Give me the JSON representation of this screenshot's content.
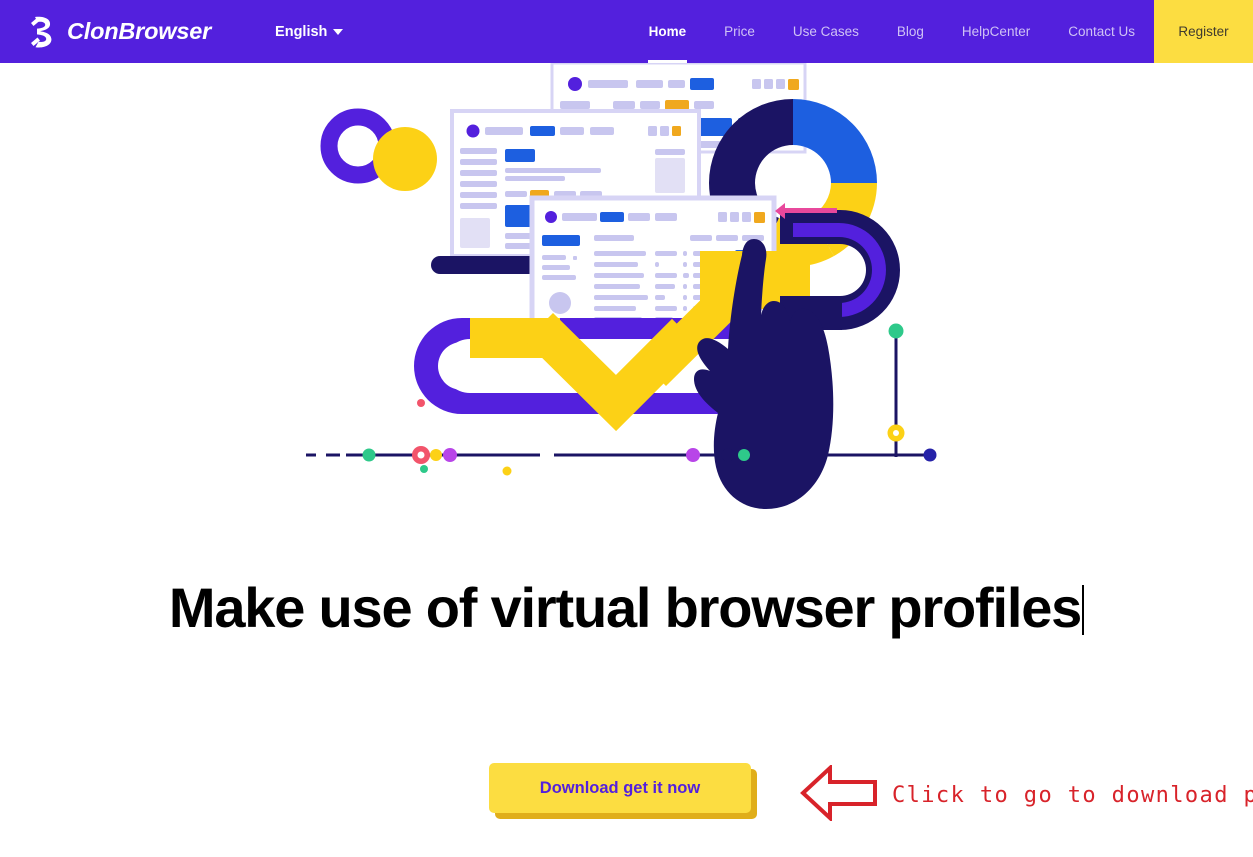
{
  "header": {
    "brand": {
      "logo_icon": "clonbrowser-logo-icon",
      "name": "ClonBrowser"
    },
    "language": {
      "label": "English",
      "caret_icon": "chevron-down-icon"
    },
    "nav": [
      {
        "label": "Home",
        "active": true
      },
      {
        "label": "Price",
        "active": false
      },
      {
        "label": "Use Cases",
        "active": false
      },
      {
        "label": "Blog",
        "active": false
      },
      {
        "label": "HelpCenter",
        "active": false
      },
      {
        "label": "Contact Us",
        "active": false
      }
    ],
    "register_label": "Register",
    "colors": {
      "bar": "#5320dd",
      "accent_yellow": "#fcdd41",
      "nav_inactive": "#cfc2f5",
      "nav_active": "#ffffff"
    }
  },
  "hero": {
    "illustration_name": "browser-profiles-illustration",
    "headline": "Make use of virtual browser profiles",
    "text_cursor": true,
    "colors": {
      "purple": "#5320dd",
      "deep_navy": "#1b1464",
      "blue": "#1d5fe0",
      "yellow": "#fcd116",
      "light_lilac": "#d7d4f5",
      "pale": "#eceaf9",
      "green": "#2ec98a",
      "pink": "#f2546b",
      "magenta": "#b845e8",
      "orange": "#f0a81e"
    }
  },
  "cta": {
    "label": "Download get it now",
    "bg": "#fcdd41",
    "shadow": "#e0ae1a",
    "text_color": "#5320dd"
  },
  "annotation": {
    "text": "Click to go to download page",
    "arrow_icon": "arrow-left-outline-icon",
    "color": "#d8232a"
  }
}
